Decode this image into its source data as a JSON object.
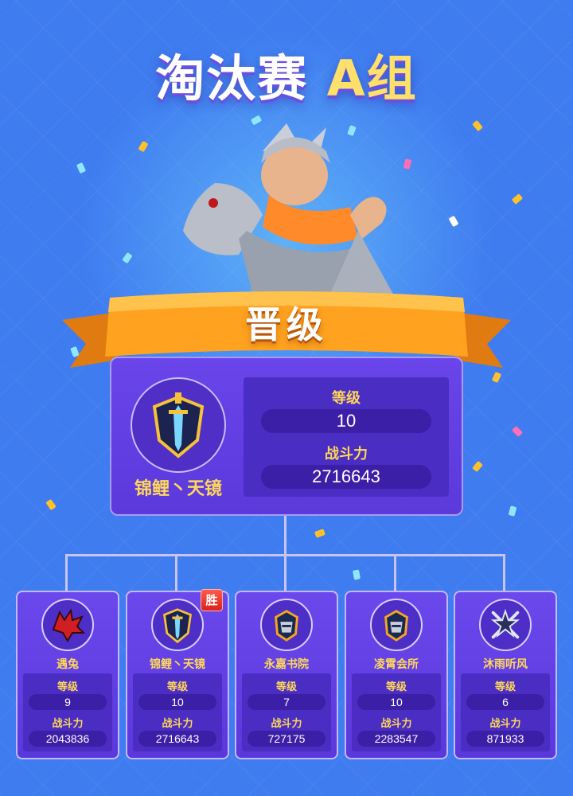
{
  "title": {
    "main": "淘汰赛 ",
    "group": "A组"
  },
  "banner": {
    "label": "晋级"
  },
  "winner": {
    "name": "锦鲤丶天镜",
    "level_label": "等级",
    "level": "10",
    "power_label": "战斗力",
    "power": "2716643",
    "emblem": "sword-shield-icon"
  },
  "teams": [
    {
      "name": "遇兔",
      "level_label": "等级",
      "level": "9",
      "power_label": "战斗力",
      "power": "2043836",
      "emblem": "red-dragon-icon",
      "winner": false
    },
    {
      "name": "锦鲤丶天镜",
      "level_label": "等级",
      "level": "10",
      "power_label": "战斗力",
      "power": "2716643",
      "emblem": "sword-shield-icon",
      "winner": true,
      "badge": "胜"
    },
    {
      "name": "永嘉书院",
      "level_label": "等级",
      "level": "7",
      "power_label": "战斗力",
      "power": "727175",
      "emblem": "knight-helmet-icon",
      "winner": false
    },
    {
      "name": "凌霄会所",
      "level_label": "等级",
      "level": "10",
      "power_label": "战斗力",
      "power": "2283547",
      "emblem": "knight-helmet-icon",
      "winner": false
    },
    {
      "name": "沐雨听风",
      "level_label": "等级",
      "level": "6",
      "power_label": "战斗力",
      "power": "871933",
      "emblem": "crossed-swords-icon",
      "winner": false
    }
  ],
  "colors": {
    "background": "#3f7cf0",
    "card": "#5b39db",
    "accent_text": "#ffd85a",
    "ribbon": "#ffa21f",
    "badge": "#e0281e"
  }
}
